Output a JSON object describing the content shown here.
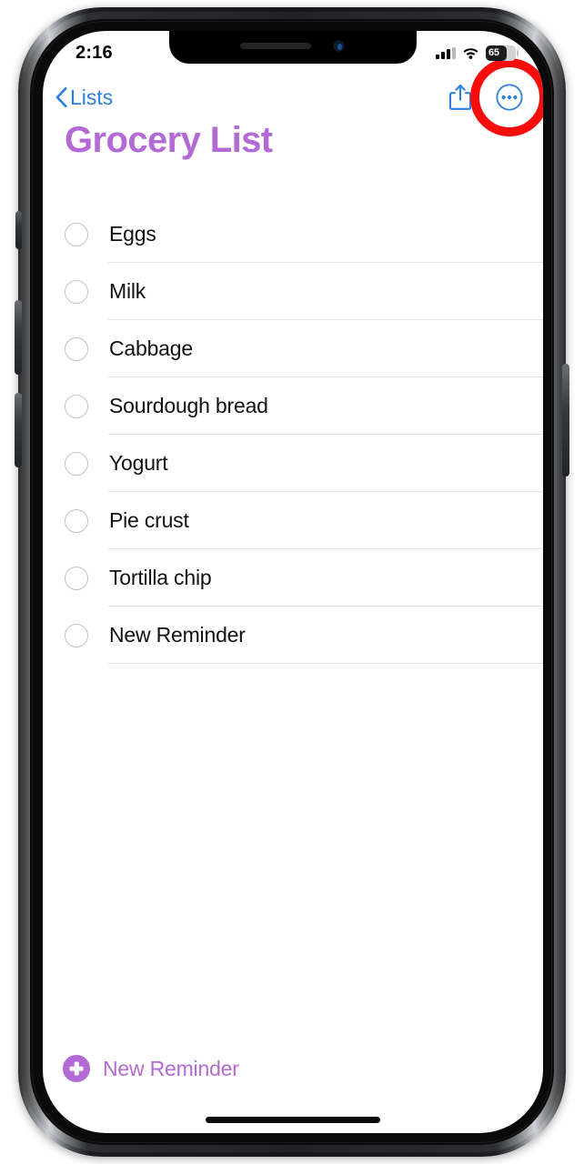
{
  "device": {
    "frame": "iphone-x-frame",
    "notch": {
      "speaker": "earpiece-speaker",
      "camera": "front-camera"
    },
    "buttons": [
      "mute-switch",
      "volume-up",
      "volume-down",
      "power"
    ]
  },
  "status_bar": {
    "time": "2:16",
    "signal_icon": "cellular-signal-icon",
    "signal_bars_filled": 3,
    "signal_bars_total": 4,
    "wifi_icon": "wifi-icon",
    "battery_icon": "battery-icon",
    "battery_level": "65"
  },
  "nav_bar": {
    "back_label": "Lists",
    "back_icon": "chevron-left-icon",
    "share_icon": "share-icon",
    "more_icon": "more-ellipsis-icon"
  },
  "annotation": {
    "type": "highlight-ring",
    "target": "more-ellipsis-button",
    "color": "#f80c0c"
  },
  "main": {
    "title": "Grocery List",
    "title_color": "#b36ad4",
    "accent_color": "#b36ad4",
    "link_color": "#2a7fe0",
    "items": [
      {
        "label": "Eggs",
        "checked": false
      },
      {
        "label": "Milk",
        "checked": false
      },
      {
        "label": "Cabbage",
        "checked": false
      },
      {
        "label": "Sourdough bread",
        "checked": false
      },
      {
        "label": "Yogurt",
        "checked": false
      },
      {
        "label": "Pie crust",
        "checked": false
      },
      {
        "label": "Tortilla chip",
        "checked": false
      },
      {
        "label": "New Reminder",
        "checked": false
      }
    ]
  },
  "footer": {
    "new_reminder_label": "New Reminder",
    "plus_icon": "plus-circle-icon"
  }
}
